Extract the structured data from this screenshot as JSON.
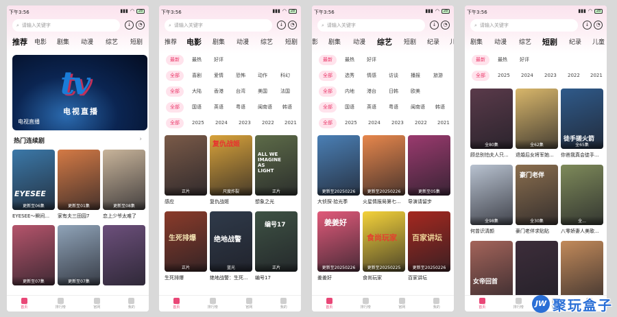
{
  "status": {
    "time": "下午3:56",
    "battery": "28"
  },
  "search": {
    "placeholder": "请输入关键字"
  },
  "screen1": {
    "categories": [
      "推荐",
      "电影",
      "剧集",
      "动漫",
      "综艺",
      "短剧"
    ],
    "banner": {
      "brand": "tv",
      "title_cn": "电视直播",
      "label": "电视直播"
    },
    "section": {
      "title": "热门连续剧"
    },
    "cards": [
      {
        "title": "EYESEE～瞬间...",
        "ep": "更新至06集",
        "color": "#3b78a8",
        "poster_text": "EYESEE"
      },
      {
        "title": "家有夫三田园7",
        "ep": "更新至01集",
        "color": "#d47a45"
      },
      {
        "title": "恋上少爷太难了",
        "ep": "更新至08集",
        "color": "#c8b49a"
      },
      {
        "title": "",
        "ep": "更新至07集",
        "color": "#b5546b"
      },
      {
        "title": "",
        "ep": "更新至07集",
        "color": "#8fa3b8"
      },
      {
        "title": "",
        "ep": "",
        "color": "#6c4f7b"
      }
    ],
    "tabs": [
      "首页",
      "排行榜",
      "官网",
      "我的"
    ]
  },
  "screen2": {
    "categories": [
      "推荐",
      "电影",
      "剧集",
      "动漫",
      "综艺",
      "短剧"
    ],
    "filters": [
      [
        "最新",
        "最热",
        "好评"
      ],
      [
        "全部",
        "喜剧",
        "爱情",
        "恐怖",
        "动作",
        "科幻"
      ],
      [
        "全部",
        "大陆",
        "香港",
        "台湾",
        "美国",
        "法国"
      ],
      [
        "全部",
        "国语",
        "英语",
        "粤语",
        "闽南语",
        "韩语"
      ],
      [
        "全部",
        "2025",
        "2024",
        "2023",
        "2022",
        "2021"
      ]
    ],
    "cards": [
      {
        "title": "感应",
        "ep": "正片",
        "color": "#7a5a48"
      },
      {
        "title": "复仇战姬",
        "ep": "尺度炸裂",
        "color": "#d8a23a",
        "poster_text": "复仇战姬"
      },
      {
        "title": "想象之光",
        "ep": "正片",
        "color": "#5d6b48",
        "poster_text": "ALL WE IMAGINE AS LIGHT"
      },
      {
        "title": "生死排爆",
        "ep": "正片",
        "color": "#8a3b2a",
        "poster_text": "生死排爆"
      },
      {
        "title": "绝地战警：生死...",
        "ep": "蓝光",
        "color": "#2f3a4a",
        "poster_text": "绝地战警"
      },
      {
        "title": "编号17",
        "ep": "正片",
        "color": "#3e5244",
        "poster_text": "编号17"
      }
    ],
    "tabs": [
      "首页",
      "排行榜",
      "官网",
      "我的"
    ]
  },
  "screen3": {
    "categories": [
      "影",
      "剧集",
      "动漫",
      "综艺",
      "短剧",
      "纪录",
      "儿"
    ],
    "filters": [
      [
        "最新",
        "最热",
        "好评"
      ],
      [
        "全部",
        "选秀",
        "情感",
        "访谈",
        "播报",
        "旅游"
      ],
      [
        "全部",
        "内地",
        "港台",
        "日韩",
        "欧美"
      ],
      [
        "全部",
        "国语",
        "英语",
        "粤语",
        "闽南语",
        "韩语"
      ],
      [
        "全部",
        "2025",
        "2024",
        "2023",
        "2022",
        "2021"
      ]
    ],
    "cards": [
      {
        "title": "大侦探·拾光季",
        "ep": "更新至20250226",
        "color": "#4a7fb5"
      },
      {
        "title": "火星情报局第七...",
        "ep": "更新至20250226",
        "color": "#e7874c"
      },
      {
        "title": "导演请留步",
        "ep": "更新至05集",
        "color": "#9a3a6e"
      },
      {
        "title": "姜姜好",
        "ep": "更新至20250226",
        "color": "#e15a7a",
        "poster_text": "姜姜好"
      },
      {
        "title": "食尚玩家",
        "ep": "更新至20250225",
        "color": "#f4d23a",
        "poster_text": "食尚玩家"
      },
      {
        "title": "百家讲坛",
        "ep": "更新至20250226",
        "color": "#a5281f",
        "poster_text": "百家讲坛"
      }
    ],
    "tabs": [
      "首页",
      "排行榜",
      "官网",
      "我的"
    ]
  },
  "screen4": {
    "categories": [
      "剧集",
      "动漫",
      "综艺",
      "短剧",
      "纪录",
      "儿童"
    ],
    "filters": [
      [
        "最新",
        "最热",
        "好评"
      ],
      [
        "全部",
        "2025",
        "2024",
        "2023",
        "2022",
        "2021"
      ]
    ],
    "cards": [
      {
        "title": "顾总别怕夫人只...",
        "ep": "全80集",
        "color": "#5a3a4a"
      },
      {
        "title": "退婚后女将军她...",
        "ep": "全62集",
        "color": "#d8b66a"
      },
      {
        "title": "你爸我真会徒手...",
        "ep": "全65集",
        "color": "#2f5a8a",
        "poster_text": "徒手搓火箭"
      },
      {
        "title": "何曾识清颜",
        "ep": "全98集",
        "color": "#b8c2d0"
      },
      {
        "title": "豪门老伴求贴贴",
        "ep": "全30集",
        "color": "#8a6e4e",
        "poster_text": "豪门老伴"
      },
      {
        "title": "八零娇妻人美歌...",
        "ep": "全...",
        "color": "#7e8a5a"
      },
      {
        "title": "",
        "ep": "",
        "color": "#a4645a",
        "poster_text": "女帝回首"
      },
      {
        "title": "",
        "ep": "",
        "color": "#3d2d3a"
      },
      {
        "title": "",
        "ep": "",
        "color": "#c28a5a"
      }
    ],
    "tabs": [
      "首页",
      "排行榜",
      "官网",
      "我的"
    ]
  },
  "watermark": {
    "logo": "JW",
    "text": "聚玩盒子"
  }
}
